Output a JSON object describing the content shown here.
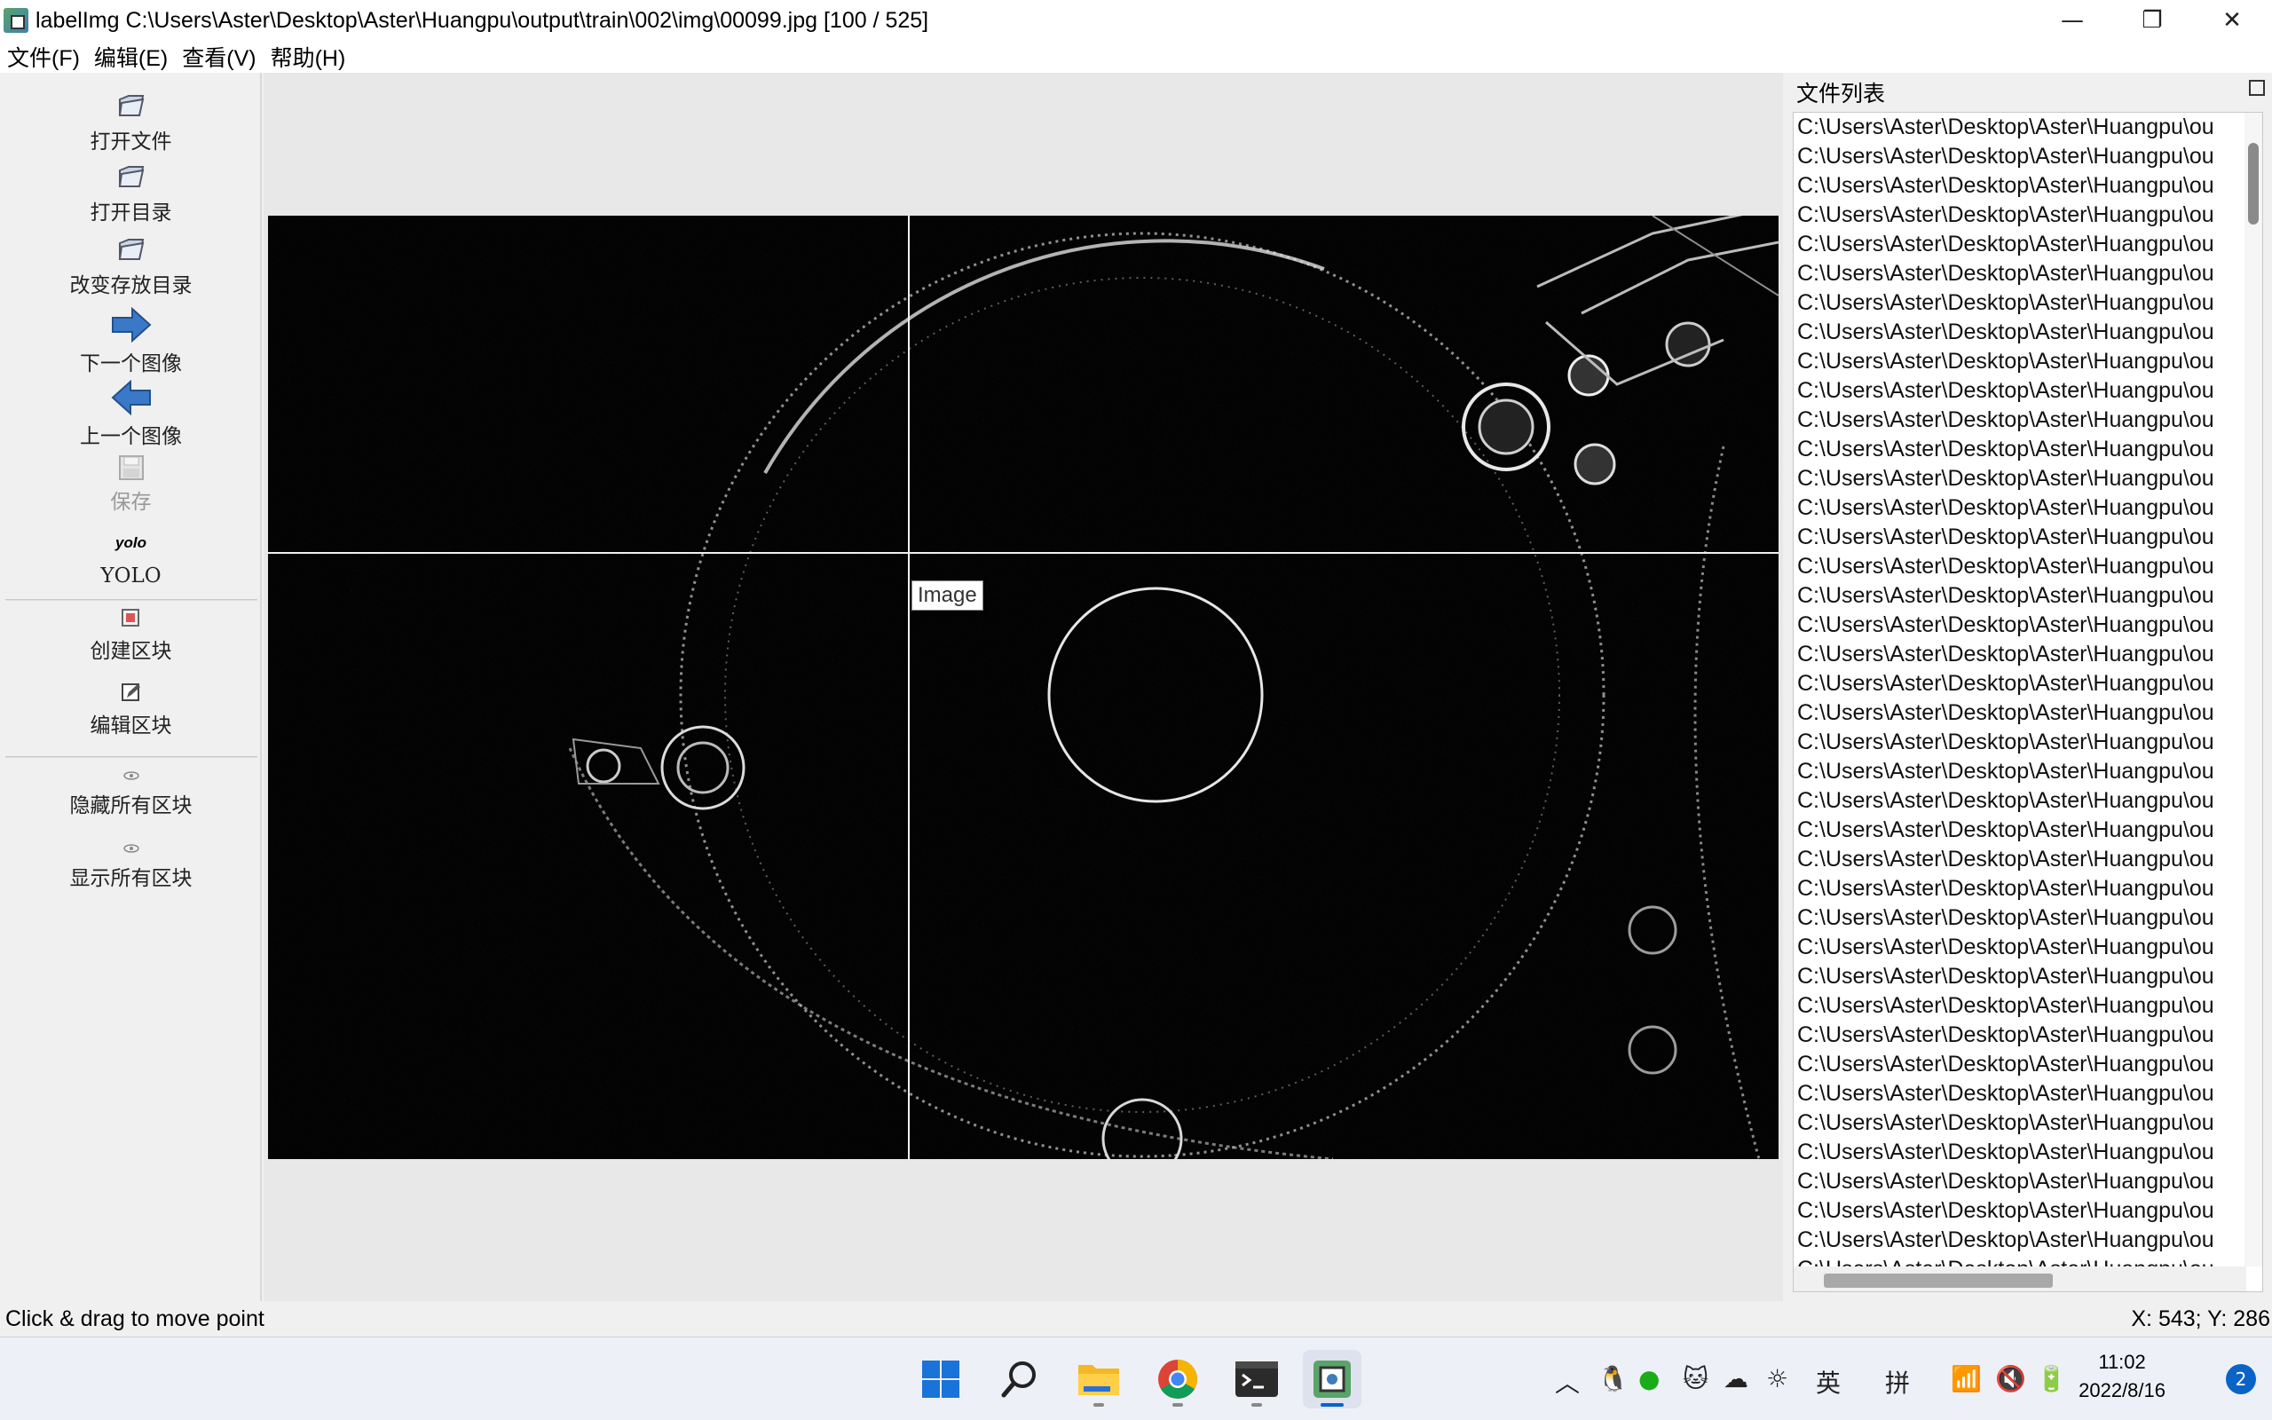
{
  "window": {
    "title": "labelImg C:\\Users\\Aster\\Desktop\\Aster\\Huangpu\\output\\train\\002\\img\\00099.jpg [100 / 525]",
    "minimize": "—",
    "maximize": "❐",
    "close": "✕"
  },
  "menu": [
    "文件(F)",
    "编辑(E)",
    "查看(V)",
    "帮助(H)"
  ],
  "toolbar": {
    "open_file": "打开文件",
    "open_dir": "打开目录",
    "change_save_dir": "改变存放目录",
    "next_image": "下一个图像",
    "prev_image": "上一个图像",
    "save": "保存",
    "format_badge": "yolo",
    "format": "YOLO",
    "create_box": "创建区块",
    "edit_box": "编辑区块",
    "hide_all": "隐藏所有区块",
    "show_all": "显示所有区块"
  },
  "canvas": {
    "tooltip": "Image"
  },
  "file_list": {
    "title": "文件列表",
    "items": [
      "C:\\Users\\Aster\\Desktop\\Aster\\Huangpu\\ou",
      "C:\\Users\\Aster\\Desktop\\Aster\\Huangpu\\ou",
      "C:\\Users\\Aster\\Desktop\\Aster\\Huangpu\\ou",
      "C:\\Users\\Aster\\Desktop\\Aster\\Huangpu\\ou",
      "C:\\Users\\Aster\\Desktop\\Aster\\Huangpu\\ou",
      "C:\\Users\\Aster\\Desktop\\Aster\\Huangpu\\ou",
      "C:\\Users\\Aster\\Desktop\\Aster\\Huangpu\\ou",
      "C:\\Users\\Aster\\Desktop\\Aster\\Huangpu\\ou",
      "C:\\Users\\Aster\\Desktop\\Aster\\Huangpu\\ou",
      "C:\\Users\\Aster\\Desktop\\Aster\\Huangpu\\ou",
      "C:\\Users\\Aster\\Desktop\\Aster\\Huangpu\\ou",
      "C:\\Users\\Aster\\Desktop\\Aster\\Huangpu\\ou",
      "C:\\Users\\Aster\\Desktop\\Aster\\Huangpu\\ou",
      "C:\\Users\\Aster\\Desktop\\Aster\\Huangpu\\ou",
      "C:\\Users\\Aster\\Desktop\\Aster\\Huangpu\\ou",
      "C:\\Users\\Aster\\Desktop\\Aster\\Huangpu\\ou",
      "C:\\Users\\Aster\\Desktop\\Aster\\Huangpu\\ou",
      "C:\\Users\\Aster\\Desktop\\Aster\\Huangpu\\ou",
      "C:\\Users\\Aster\\Desktop\\Aster\\Huangpu\\ou",
      "C:\\Users\\Aster\\Desktop\\Aster\\Huangpu\\ou",
      "C:\\Users\\Aster\\Desktop\\Aster\\Huangpu\\ou",
      "C:\\Users\\Aster\\Desktop\\Aster\\Huangpu\\ou",
      "C:\\Users\\Aster\\Desktop\\Aster\\Huangpu\\ou",
      "C:\\Users\\Aster\\Desktop\\Aster\\Huangpu\\ou",
      "C:\\Users\\Aster\\Desktop\\Aster\\Huangpu\\ou",
      "C:\\Users\\Aster\\Desktop\\Aster\\Huangpu\\ou",
      "C:\\Users\\Aster\\Desktop\\Aster\\Huangpu\\ou",
      "C:\\Users\\Aster\\Desktop\\Aster\\Huangpu\\ou",
      "C:\\Users\\Aster\\Desktop\\Aster\\Huangpu\\ou",
      "C:\\Users\\Aster\\Desktop\\Aster\\Huangpu\\ou",
      "C:\\Users\\Aster\\Desktop\\Aster\\Huangpu\\ou",
      "C:\\Users\\Aster\\Desktop\\Aster\\Huangpu\\ou",
      "C:\\Users\\Aster\\Desktop\\Aster\\Huangpu\\ou",
      "C:\\Users\\Aster\\Desktop\\Aster\\Huangpu\\ou",
      "C:\\Users\\Aster\\Desktop\\Aster\\Huangpu\\ou",
      "C:\\Users\\Aster\\Desktop\\Aster\\Huangpu\\ou",
      "C:\\Users\\Aster\\Desktop\\Aster\\Huangpu\\ou",
      "C:\\Users\\Aster\\Desktop\\Aster\\Huangpu\\ou",
      "C:\\Users\\Aster\\Desktop\\Aster\\Huangpu\\ou",
      "C:\\Users\\Aster\\Desktop\\Aster\\Huangpu\\ou"
    ]
  },
  "status": {
    "message": "Click & drag to move point",
    "coords": "X: 543; Y: 286"
  },
  "taskbar": {
    "apps": [
      "start-icon",
      "search-icon",
      "file-explorer-icon",
      "chrome-icon",
      "terminal-icon",
      "labelimg-icon"
    ],
    "ime_lang": "英",
    "ime_mode": "拼",
    "time": "11:02",
    "date": "2022/8/16",
    "notifications": "2"
  },
  "colors": {
    "accent": "#0a64c8",
    "arrow_blue": "#3a78c8"
  }
}
